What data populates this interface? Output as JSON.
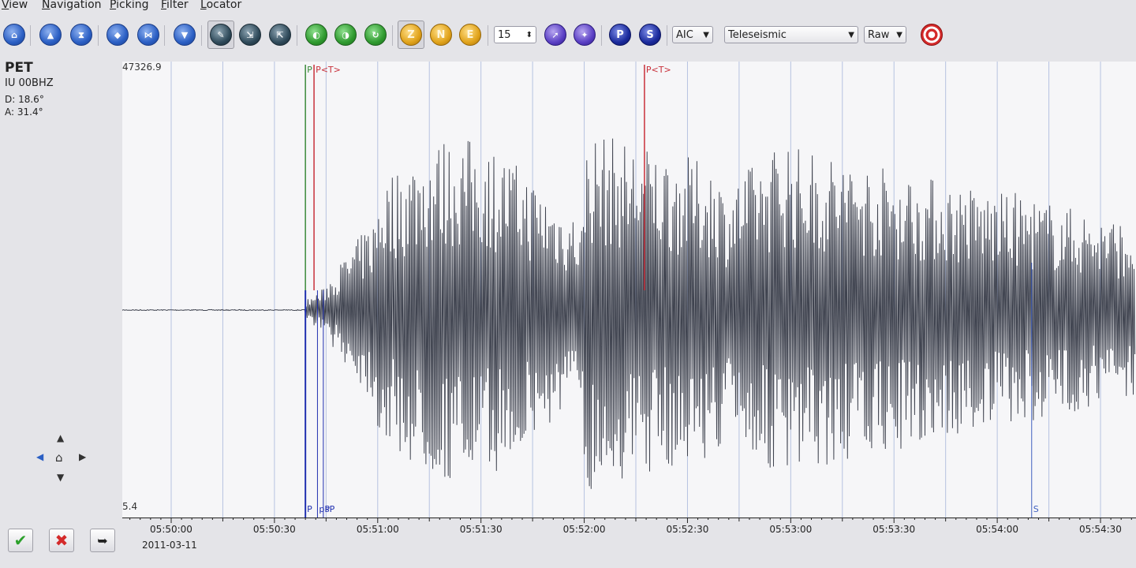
{
  "menu": [
    "View",
    "Navigation",
    "Picking",
    "Filter",
    "Locator"
  ],
  "toolbar": {
    "zoom_value": "15",
    "picker_method": "AIC",
    "phase_list": "Teleseismic",
    "data_mode": "Raw",
    "component_buttons": [
      "Z",
      "N",
      "E"
    ],
    "pick_buttons": [
      "P",
      "S"
    ],
    "icons": [
      "home-icon",
      "scroll-up-icon",
      "scroll-down-icon",
      "scroll-left-icon",
      "fit-horizontal-icon",
      "scroll-bottom-icon",
      "pick-tool-icon",
      "measure-tool-icon",
      "amplitude-tool-icon",
      "previous-trace-icon",
      "next-trace-icon",
      "refresh-trace-icon",
      "compass-icon",
      "undo-pick-icon",
      "target-icon"
    ]
  },
  "station": {
    "code": "PET",
    "channel": "IU  00BHZ",
    "distance": "D:  18.6°",
    "azimuth": "A:  31.4°"
  },
  "plot": {
    "max_amplitude": "47326.9",
    "min_amplitude": "5.4",
    "picks": {
      "top": [
        {
          "label": "P",
          "time_s": 39.0,
          "color": "#3a8a3a"
        },
        {
          "label": "P<T>",
          "time_s": 41.5,
          "color": "#c8303a"
        },
        {
          "label": "P<T>",
          "time_s": 137.5,
          "color": "#c8303a"
        }
      ],
      "bottom": [
        {
          "label": "P",
          "time_s": 39.0,
          "color": "#2030b0"
        },
        {
          "label": "pP",
          "time_s": 42.5,
          "color": "#2030b0"
        },
        {
          "label": "sP",
          "time_s": 44.2,
          "color": "#2030b0"
        },
        {
          "label": "S",
          "time_s": 250.0,
          "color": "#4060c0"
        }
      ]
    },
    "trace_color": "#404450"
  },
  "axis": {
    "start": "05:49:45.5",
    "end": "05:54:40",
    "ticks": [
      "05:50:00",
      "05:50:30",
      "05:51:00",
      "05:51:30",
      "05:52:00",
      "05:52:30",
      "05:53:00",
      "05:53:30",
      "05:54:00",
      "05:54:30"
    ],
    "date": "2011-03-11"
  },
  "bottom_buttons": [
    "confirm-icon",
    "cancel-icon",
    "export-icon"
  ]
}
